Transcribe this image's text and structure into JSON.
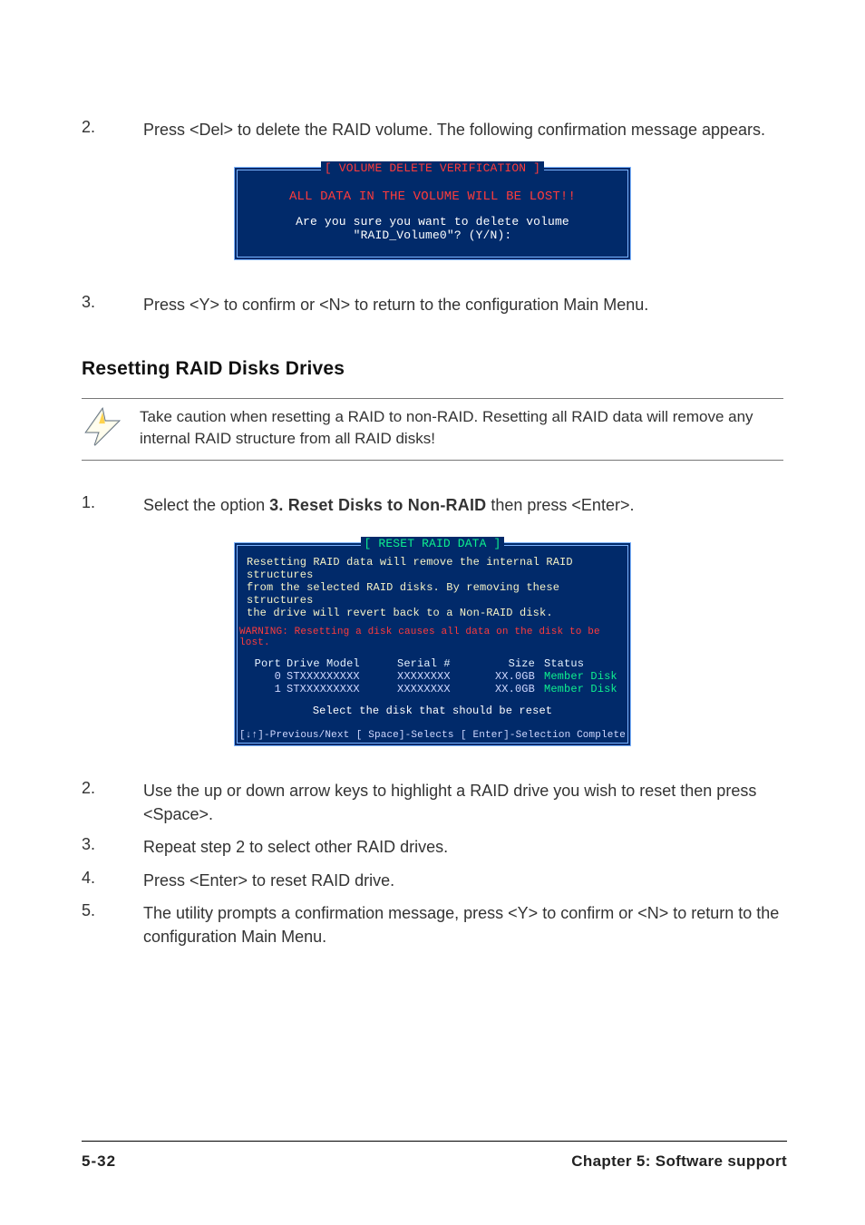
{
  "step2": {
    "num": "2.",
    "text": "Press <Del> to delete the RAID volume. The following confirmation message appears."
  },
  "dlg1": {
    "title": "[ VOLUME DELETE VERIFICATION ]",
    "warn": "ALL DATA IN THE VOLUME WILL BE LOST!!",
    "ask": "Are you sure you want to delete volume \"RAID_Volume0\"? (Y/N):"
  },
  "step3a": {
    "num": "3.",
    "text": "Press <Y> to confirm or <N> to return to the configuration Main Menu."
  },
  "section_title": "Resetting RAID Disks Drives",
  "note": "Take caution when resetting a RAID to non-RAID. Resetting all RAID data will remove any internal RAID structure from all RAID disks!",
  "step1": {
    "num": "1.",
    "lead": "Select the option ",
    "bold": "3. Reset Disks to Non-RAID",
    "tail": " then press <Enter>."
  },
  "dlg2": {
    "title": "[ RESET RAID DATA ]",
    "intro1": "Resetting RAID data will remove the internal RAID structures",
    "intro2": "from the selected RAID disks. By removing these structures",
    "intro3": "the drive will revert back to a Non-RAID disk.",
    "warn": "WARNING: Resetting a disk causes all data on the disk to be lost.",
    "head": {
      "port": "Port",
      "model": "Drive Model",
      "serial": "Serial #",
      "size": "Size",
      "status": "Status"
    },
    "rows": [
      {
        "port": "0",
        "model": "STXXXXXXXXX",
        "serial": "XXXXXXXX",
        "size": "XX.0GB",
        "status": "Member Disk"
      },
      {
        "port": "1",
        "model": "STXXXXXXXXX",
        "serial": "XXXXXXXX",
        "size": "XX.0GB",
        "status": "Member Disk"
      }
    ],
    "select": "Select the disk that should be reset",
    "foot_left": "[↓↑]-Previous/Next",
    "foot_mid": "[ Space]-Selects",
    "foot_right": "[ Enter]-Selection Complete"
  },
  "stepsB": {
    "s2": {
      "num": "2.",
      "text": "Use the up or down arrow keys to highlight a RAID drive you wish to reset then press <Space>."
    },
    "s3": {
      "num": "3.",
      "text": "Repeat step 2 to select other RAID drives."
    },
    "s4": {
      "num": "4.",
      "text": "Press <Enter> to reset RAID drive."
    },
    "s5": {
      "num": "5.",
      "text": "The utility prompts a confirmation message, press <Y> to confirm or <N> to return to the configuration Main Menu."
    }
  },
  "footer": {
    "page": "5-32",
    "chapter": "Chapter 5: Software support"
  }
}
